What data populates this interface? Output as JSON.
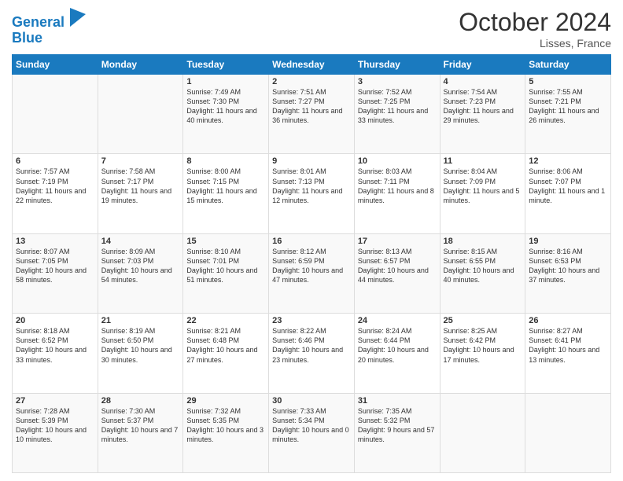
{
  "header": {
    "logo_line1": "General",
    "logo_line2": "Blue",
    "month": "October 2024",
    "location": "Lisses, France"
  },
  "weekdays": [
    "Sunday",
    "Monday",
    "Tuesday",
    "Wednesday",
    "Thursday",
    "Friday",
    "Saturday"
  ],
  "weeks": [
    [
      {
        "day": "",
        "info": ""
      },
      {
        "day": "",
        "info": ""
      },
      {
        "day": "1",
        "info": "Sunrise: 7:49 AM\nSunset: 7:30 PM\nDaylight: 11 hours and 40 minutes."
      },
      {
        "day": "2",
        "info": "Sunrise: 7:51 AM\nSunset: 7:27 PM\nDaylight: 11 hours and 36 minutes."
      },
      {
        "day": "3",
        "info": "Sunrise: 7:52 AM\nSunset: 7:25 PM\nDaylight: 11 hours and 33 minutes."
      },
      {
        "day": "4",
        "info": "Sunrise: 7:54 AM\nSunset: 7:23 PM\nDaylight: 11 hours and 29 minutes."
      },
      {
        "day": "5",
        "info": "Sunrise: 7:55 AM\nSunset: 7:21 PM\nDaylight: 11 hours and 26 minutes."
      }
    ],
    [
      {
        "day": "6",
        "info": "Sunrise: 7:57 AM\nSunset: 7:19 PM\nDaylight: 11 hours and 22 minutes."
      },
      {
        "day": "7",
        "info": "Sunrise: 7:58 AM\nSunset: 7:17 PM\nDaylight: 11 hours and 19 minutes."
      },
      {
        "day": "8",
        "info": "Sunrise: 8:00 AM\nSunset: 7:15 PM\nDaylight: 11 hours and 15 minutes."
      },
      {
        "day": "9",
        "info": "Sunrise: 8:01 AM\nSunset: 7:13 PM\nDaylight: 11 hours and 12 minutes."
      },
      {
        "day": "10",
        "info": "Sunrise: 8:03 AM\nSunset: 7:11 PM\nDaylight: 11 hours and 8 minutes."
      },
      {
        "day": "11",
        "info": "Sunrise: 8:04 AM\nSunset: 7:09 PM\nDaylight: 11 hours and 5 minutes."
      },
      {
        "day": "12",
        "info": "Sunrise: 8:06 AM\nSunset: 7:07 PM\nDaylight: 11 hours and 1 minute."
      }
    ],
    [
      {
        "day": "13",
        "info": "Sunrise: 8:07 AM\nSunset: 7:05 PM\nDaylight: 10 hours and 58 minutes."
      },
      {
        "day": "14",
        "info": "Sunrise: 8:09 AM\nSunset: 7:03 PM\nDaylight: 10 hours and 54 minutes."
      },
      {
        "day": "15",
        "info": "Sunrise: 8:10 AM\nSunset: 7:01 PM\nDaylight: 10 hours and 51 minutes."
      },
      {
        "day": "16",
        "info": "Sunrise: 8:12 AM\nSunset: 6:59 PM\nDaylight: 10 hours and 47 minutes."
      },
      {
        "day": "17",
        "info": "Sunrise: 8:13 AM\nSunset: 6:57 PM\nDaylight: 10 hours and 44 minutes."
      },
      {
        "day": "18",
        "info": "Sunrise: 8:15 AM\nSunset: 6:55 PM\nDaylight: 10 hours and 40 minutes."
      },
      {
        "day": "19",
        "info": "Sunrise: 8:16 AM\nSunset: 6:53 PM\nDaylight: 10 hours and 37 minutes."
      }
    ],
    [
      {
        "day": "20",
        "info": "Sunrise: 8:18 AM\nSunset: 6:52 PM\nDaylight: 10 hours and 33 minutes."
      },
      {
        "day": "21",
        "info": "Sunrise: 8:19 AM\nSunset: 6:50 PM\nDaylight: 10 hours and 30 minutes."
      },
      {
        "day": "22",
        "info": "Sunrise: 8:21 AM\nSunset: 6:48 PM\nDaylight: 10 hours and 27 minutes."
      },
      {
        "day": "23",
        "info": "Sunrise: 8:22 AM\nSunset: 6:46 PM\nDaylight: 10 hours and 23 minutes."
      },
      {
        "day": "24",
        "info": "Sunrise: 8:24 AM\nSunset: 6:44 PM\nDaylight: 10 hours and 20 minutes."
      },
      {
        "day": "25",
        "info": "Sunrise: 8:25 AM\nSunset: 6:42 PM\nDaylight: 10 hours and 17 minutes."
      },
      {
        "day": "26",
        "info": "Sunrise: 8:27 AM\nSunset: 6:41 PM\nDaylight: 10 hours and 13 minutes."
      }
    ],
    [
      {
        "day": "27",
        "info": "Sunrise: 7:28 AM\nSunset: 5:39 PM\nDaylight: 10 hours and 10 minutes."
      },
      {
        "day": "28",
        "info": "Sunrise: 7:30 AM\nSunset: 5:37 PM\nDaylight: 10 hours and 7 minutes."
      },
      {
        "day": "29",
        "info": "Sunrise: 7:32 AM\nSunset: 5:35 PM\nDaylight: 10 hours and 3 minutes."
      },
      {
        "day": "30",
        "info": "Sunrise: 7:33 AM\nSunset: 5:34 PM\nDaylight: 10 hours and 0 minutes."
      },
      {
        "day": "31",
        "info": "Sunrise: 7:35 AM\nSunset: 5:32 PM\nDaylight: 9 hours and 57 minutes."
      },
      {
        "day": "",
        "info": ""
      },
      {
        "day": "",
        "info": ""
      }
    ]
  ]
}
